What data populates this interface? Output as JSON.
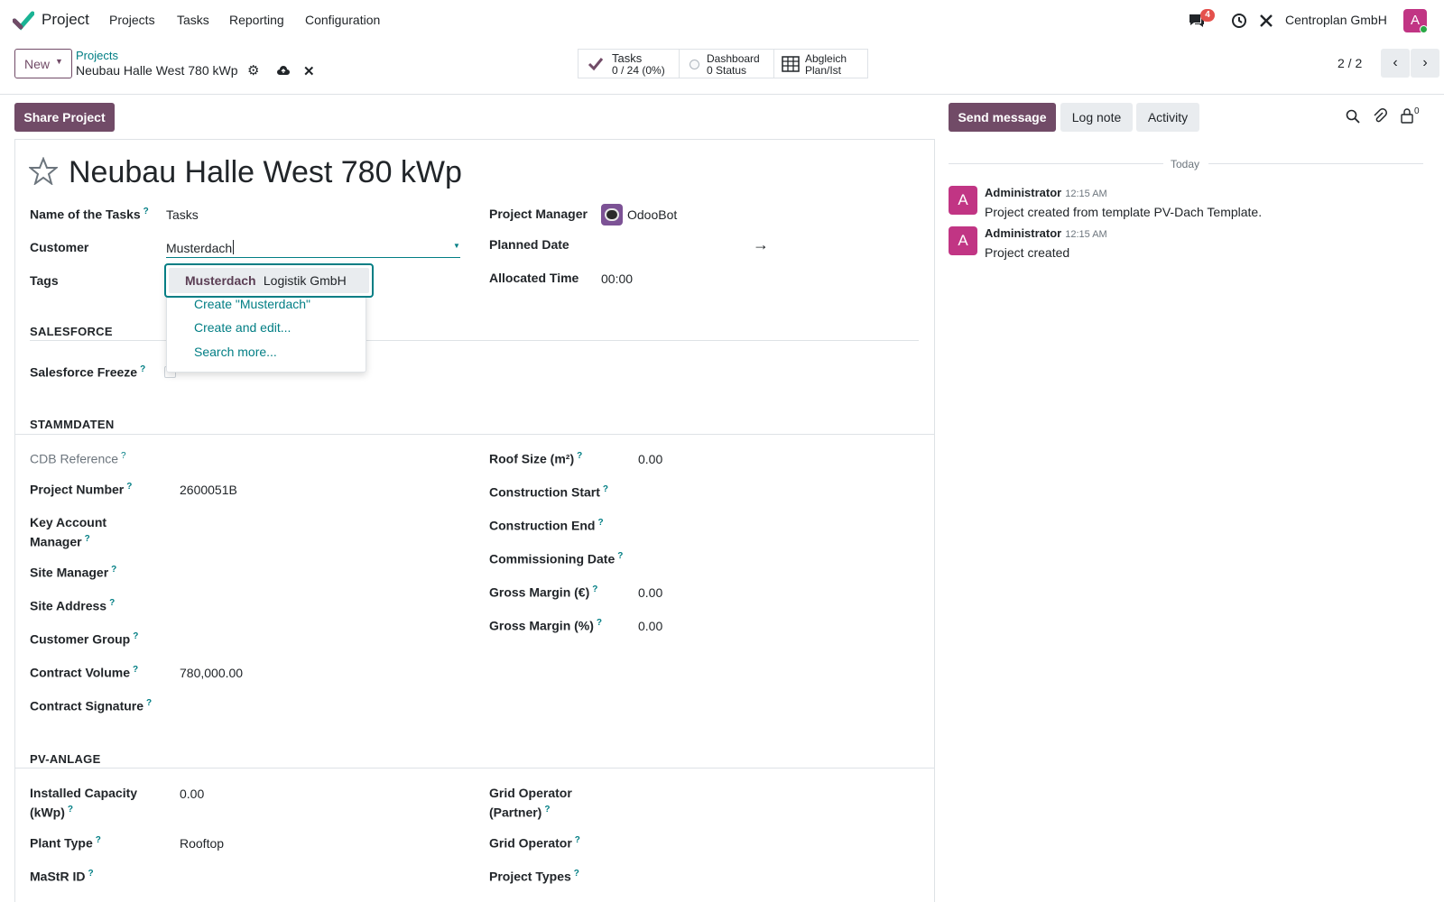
{
  "navbar": {
    "app_name": "Project",
    "menu": [
      "Projects",
      "Tasks",
      "Reporting",
      "Configuration"
    ],
    "messages_badge": "4",
    "company": "Centroplan GmbH",
    "user_initial": "A"
  },
  "control": {
    "new_label": "New",
    "breadcrumb": "Projects",
    "record_name": "Neubau Halle West 780 kWp",
    "smart_buttons": [
      {
        "label": "Tasks",
        "sub": "0 / 24 (0%)",
        "icon": "check-icon"
      },
      {
        "label": "Dashboard",
        "sub": "0 Status",
        "icon": "circle-icon"
      },
      {
        "label": "Abgleich",
        "sub": "Plan/Ist",
        "icon": "table-icon"
      }
    ],
    "pager": "2 / 2"
  },
  "actions": {
    "share": "Share Project"
  },
  "chatter": {
    "send_message": "Send message",
    "log_note": "Log note",
    "activity": "Activity",
    "followers_count": "0",
    "date_sep": "Today",
    "messages": [
      {
        "author": "Administrator",
        "time": "12:15 AM",
        "body": "Project created from template PV-Dach Template."
      },
      {
        "author": "Administrator",
        "time": "12:15 AM",
        "body": "Project created"
      }
    ]
  },
  "form": {
    "title": "Neubau Halle West 780 kWp",
    "name_of_tasks_label": "Name of the Tasks",
    "name_of_tasks_value": "Tasks",
    "customer_label": "Customer",
    "customer_value": "Musterdach",
    "tags_label": "Tags",
    "project_manager_label": "Project Manager",
    "project_manager_value": "OdooBot",
    "planned_date_label": "Planned Date",
    "allocated_time_label": "Allocated Time",
    "allocated_time_value": "00:00",
    "dropdown": {
      "match_bold": "Musterdach",
      "match_rest": " Logistik GmbH",
      "create": "Create \"Musterdach\"",
      "create_edit": "Create and edit...",
      "search_more": "Search more..."
    },
    "sections": {
      "salesforce": "SALESFORCE",
      "stammdaten": "STAMMDATEN",
      "pv_anlage": "PV-ANLAGE"
    },
    "salesforce_freeze_label": "Salesforce Freeze",
    "left_fields": [
      {
        "label": "CDB Reference",
        "value": ""
      },
      {
        "label": "Project Number",
        "value": "2600051B"
      },
      {
        "label": "Key Account",
        "label2": "Manager",
        "value": ""
      },
      {
        "label": "Site Manager",
        "value": ""
      },
      {
        "label": "Site Address",
        "value": ""
      },
      {
        "label": "Customer Group",
        "value": ""
      },
      {
        "label": "Contract Volume",
        "value": "780,000.00"
      },
      {
        "label": "Contract Signature",
        "value": ""
      }
    ],
    "right_fields": [
      {
        "label": "Roof Size (m²)",
        "value": "0.00"
      },
      {
        "label": "Construction Start",
        "value": ""
      },
      {
        "label": "Construction End",
        "value": ""
      },
      {
        "label": "Commissioning Date",
        "value": ""
      },
      {
        "label": "Gross Margin (€)",
        "value": "0.00"
      },
      {
        "label": "Gross Margin (%)",
        "value": "0.00"
      }
    ],
    "pv_left": [
      {
        "label": "Installed Capacity",
        "label2": "(kWp)",
        "value": "0.00"
      },
      {
        "label": "Plant Type",
        "value": "Rooftop"
      },
      {
        "label": "MaStR ID",
        "value": ""
      }
    ],
    "pv_right": [
      {
        "label": "Grid Operator",
        "label2": "(Partner)",
        "value": ""
      },
      {
        "label": "Grid Operator",
        "value": ""
      },
      {
        "label": "Project Types",
        "value": ""
      }
    ]
  },
  "colors": {
    "brand": "#714b67",
    "link": "#017e84"
  }
}
